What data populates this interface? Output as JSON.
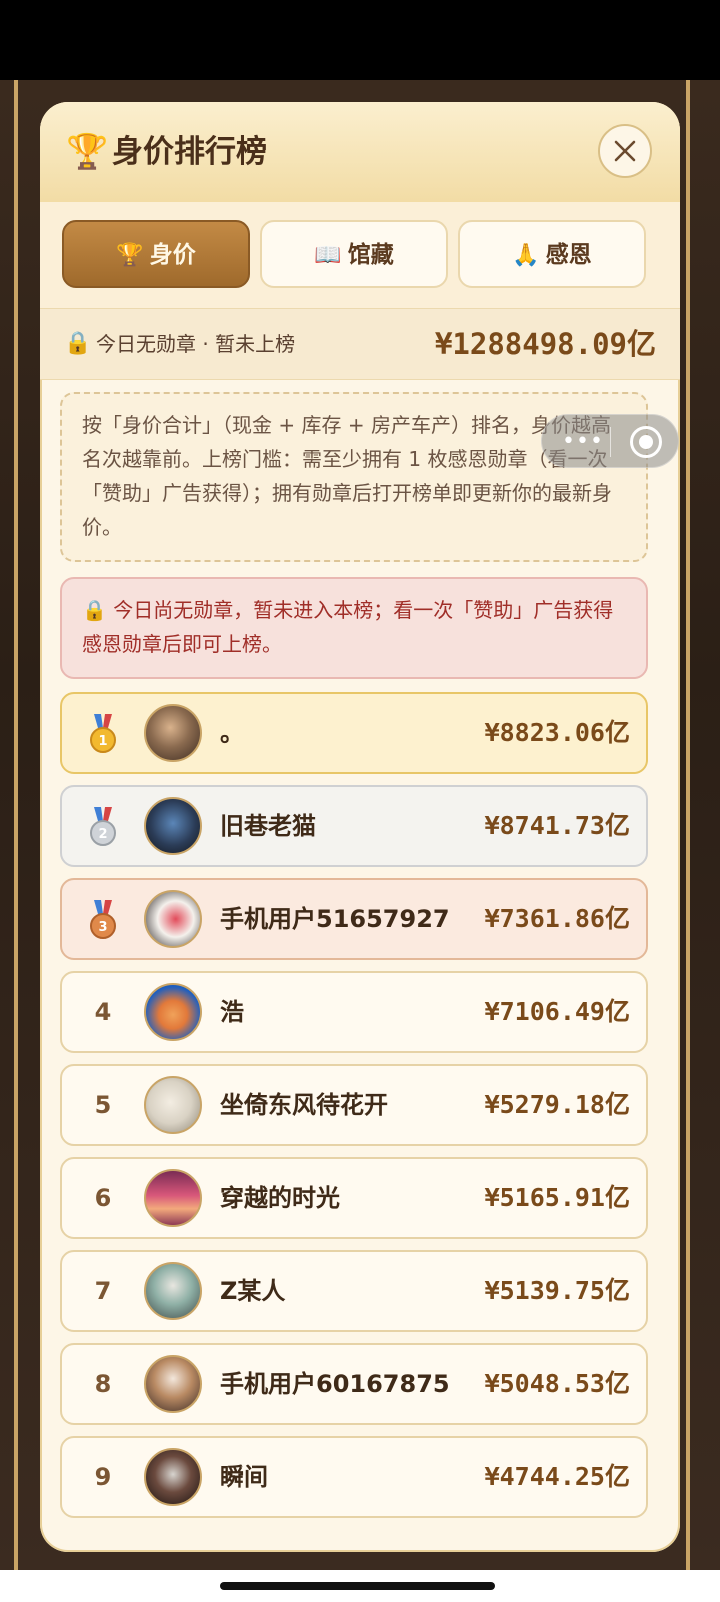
{
  "modal": {
    "title": "身价排行榜",
    "title_icon": "🏆"
  },
  "tabs": [
    {
      "icon": "🏆",
      "label": "身价",
      "active": true
    },
    {
      "icon": "📖",
      "label": "馆藏",
      "active": false
    },
    {
      "icon": "🙏",
      "label": "感恩",
      "active": false
    }
  ],
  "status": {
    "lock_icon": "🔒",
    "text": "今日无勋章 · 暂未上榜",
    "value": "¥1288498.09亿"
  },
  "info_text": "按「身价合计」（现金 + 库存 + 房产车产）排名，身价越高名次越靠前。上榜门槛：需至少拥有 1 枚感恩勋章（看一次「赞助」广告获得）；拥有勋章后打开榜单即更新你的最新身价。",
  "warning_text": "🔒 今日尚无勋章，暂未进入本榜；看一次「赞助」广告获得感恩勋章后即可上榜。",
  "leaderboard": [
    {
      "rank": "1",
      "name": "。",
      "value": "¥8823.06亿"
    },
    {
      "rank": "2",
      "name": "旧巷老猫",
      "value": "¥8741.73亿"
    },
    {
      "rank": "3",
      "name": "手机用户51657927",
      "value": "¥7361.86亿"
    },
    {
      "rank": "4",
      "name": "浩",
      "value": "¥7106.49亿"
    },
    {
      "rank": "5",
      "name": "坐倚东风待花开",
      "value": "¥5279.18亿"
    },
    {
      "rank": "6",
      "name": "穿越的时光",
      "value": "¥5165.91亿"
    },
    {
      "rank": "7",
      "name": "Z某人",
      "value": "¥5139.75亿"
    },
    {
      "rank": "8",
      "name": "手机用户60167875",
      "value": "¥5048.53亿"
    },
    {
      "rank": "9",
      "name": "瞬间",
      "value": "¥4744.25亿"
    }
  ],
  "mini_program": {
    "dots": "•••"
  },
  "colors": {
    "accent": "#9f6a2c",
    "value_text": "#7a4a1a",
    "warning_text": "#a02e28",
    "gold": "#e8c667",
    "silver": "#cfd0d2",
    "bronze": "#e3b898"
  }
}
